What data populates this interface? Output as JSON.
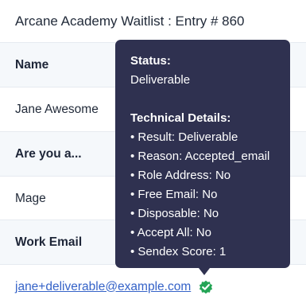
{
  "title": "Arcane Academy Waitlist : Entry # 860",
  "rows": [
    {
      "label": "Name",
      "value": "Jane Awesome"
    },
    {
      "label": "Are you a...",
      "value": "Mage"
    },
    {
      "label": "Work Email",
      "value": "jane+deliverable@example.com"
    }
  ],
  "verify_icon": "check-badge-icon",
  "colors": {
    "accent": "#3563c8",
    "tooltip_bg": "#2f3150",
    "verified": "#23a455"
  },
  "tooltip": {
    "status_heading": "Status:",
    "status_value": "Deliverable",
    "details_heading": "Technical Details:",
    "details": [
      "• Result: Deliverable",
      "• Reason: Accepted_email",
      "• Role Address: No",
      "• Free Email: No",
      "• Disposable: No",
      "• Accept All: No",
      "• Sendex Score: 1"
    ]
  }
}
